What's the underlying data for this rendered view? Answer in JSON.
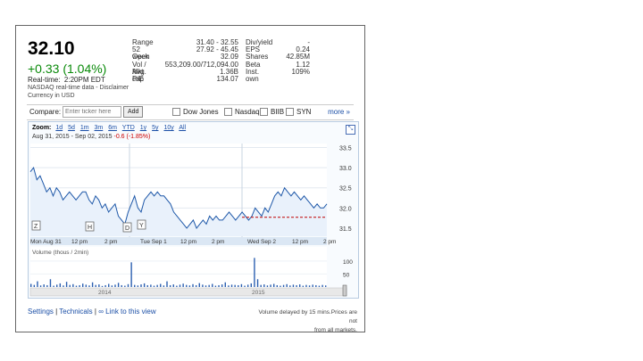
{
  "quote": {
    "price": "32.10",
    "change": "+0.33 (1.04%)",
    "realtime_label": "Real-time:",
    "realtime_time": "2:20PM EDT",
    "source_line": "NASDAQ real-time data - Disclaimer",
    "currency_line": "Currency in USD"
  },
  "stats_left": [
    {
      "key": "Range",
      "value": "31.40 - 32.55"
    },
    {
      "key": "52 week",
      "value": "27.92 - 45.45"
    },
    {
      "key": "Open",
      "value": "32.09"
    },
    {
      "key": "Vol / Avg.",
      "value": "553,209.00/712,094.00"
    },
    {
      "key": "Mkt cap",
      "value": "1.36B"
    },
    {
      "key": "P/E",
      "value": "134.07"
    }
  ],
  "stats_right": [
    {
      "key": "Div/yield",
      "value": "-"
    },
    {
      "key": "EPS",
      "value": "0.24"
    },
    {
      "key": "Shares",
      "value": "42.85M"
    },
    {
      "key": "Beta",
      "value": "1.12"
    },
    {
      "key": "Inst. own",
      "value": "109%"
    }
  ],
  "compare": {
    "label": "Compare:",
    "placeholder": "Enter ticker here",
    "add_label": "Add",
    "options": [
      "Dow Jones",
      "Nasdaq",
      "BIIB",
      "SYN"
    ],
    "more_label": "more »"
  },
  "zoom": {
    "label": "Zoom:",
    "options": [
      "1d",
      "5d",
      "1m",
      "3m",
      "6m",
      "YTD",
      "1y",
      "5y",
      "10y",
      "All"
    ]
  },
  "date_range": {
    "text": "Aug 31, 2015 - Sep 02, 2015",
    "change": "-0.6 (-1.85%)"
  },
  "chart_data": {
    "type": "line",
    "title": "",
    "x": [
      "Mon Aug 31",
      "12 pm",
      "2 pm",
      "Tue Sep 1",
      "12 pm",
      "2 pm",
      "Wed Sep 2",
      "12 pm",
      "2 pm"
    ],
    "y_ticks": [
      "33.5",
      "33.0",
      "32.5",
      "32.0",
      "31.5"
    ],
    "ylim": [
      31.3,
      33.6
    ],
    "previous_close": 31.77,
    "price_series": [
      32.9,
      33.0,
      32.7,
      32.8,
      32.6,
      32.4,
      32.5,
      32.3,
      32.5,
      32.4,
      32.2,
      32.3,
      32.4,
      32.3,
      32.2,
      32.3,
      32.4,
      32.4,
      32.2,
      32.1,
      32.3,
      32.2,
      32.0,
      32.1,
      31.9,
      32.0,
      32.1,
      31.8,
      31.7,
      31.6,
      31.9,
      32.1,
      32.3,
      32.0,
      31.9,
      32.2,
      32.3,
      32.4,
      32.3,
      32.4,
      32.3,
      32.3,
      32.2,
      32.1,
      31.9,
      31.8,
      31.7,
      31.6,
      31.5,
      31.6,
      31.7,
      31.5,
      31.6,
      31.7,
      31.6,
      31.8,
      31.7,
      31.8,
      31.7,
      31.7,
      31.8,
      31.9,
      31.8,
      31.7,
      31.8,
      31.9,
      31.8,
      31.7,
      31.8,
      32.0,
      31.9,
      31.8,
      32.0,
      31.9,
      32.1,
      32.3,
      32.4,
      32.3,
      32.5,
      32.4,
      32.3,
      32.4,
      32.3,
      32.2,
      32.3,
      32.2,
      32.1,
      32.0,
      32.1,
      32.0,
      32.0,
      32.1
    ],
    "event_markers": [
      "Z",
      "H",
      "D",
      "Y"
    ],
    "volume_label": "Volume (thous / 2min)",
    "volume_ticks": [
      "100",
      "50"
    ],
    "volume_series": [
      12,
      8,
      22,
      6,
      10,
      7,
      30,
      5,
      9,
      14,
      6,
      20,
      8,
      11,
      5,
      7,
      13,
      9,
      6,
      18,
      8,
      10,
      4,
      7,
      12,
      6,
      9,
      16,
      7,
      5,
      11,
      95,
      8,
      6,
      10,
      14,
      7,
      9,
      5,
      8,
      12,
      6,
      22,
      7,
      10,
      5,
      9,
      13,
      8,
      6,
      11,
      7,
      15,
      9,
      6,
      8,
      12,
      5,
      7,
      10,
      18,
      6,
      9,
      8,
      7,
      11,
      5,
      9,
      14,
      112,
      30,
      8,
      10,
      6,
      9,
      12,
      7,
      5,
      8,
      11,
      6,
      9,
      7,
      10,
      5,
      8,
      6,
      9,
      7,
      5,
      8,
      6
    ],
    "timeline_labels": [
      "2014",
      "2015"
    ]
  },
  "footer": {
    "settings": "Settings",
    "technicals": "Technicals",
    "link_view": "Link to this view",
    "separator": "|",
    "note_line1": "Volume delayed by 15 mins.Prices are not",
    "note_line2": "from all markets."
  },
  "colors": {
    "price_line": "#1d57a8",
    "positive": "#0a8a0a",
    "negative": "#c00000",
    "link": "#1a4ea6"
  }
}
